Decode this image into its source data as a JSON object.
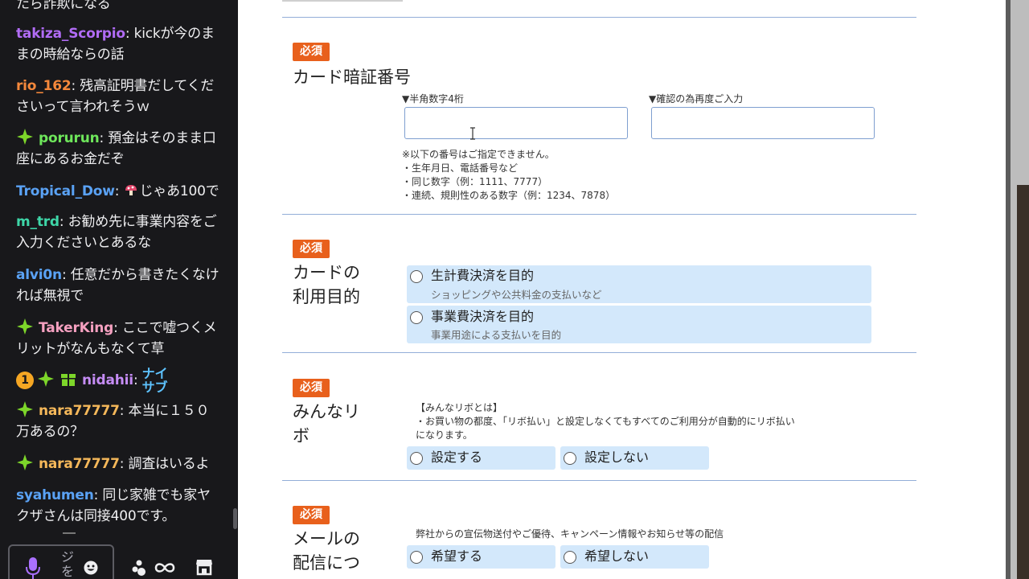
{
  "chat": {
    "messages": [
      {
        "user": "",
        "text": "たら詐欺になる"
      },
      {
        "user": "takiza_Scorpio",
        "color": "#b16cf5",
        "text": "kickが今のままの時給ならの話"
      },
      {
        "user": "rio_162",
        "color": "#f5883b",
        "text": "残高証明書だしてくださいって言われそうｗ"
      },
      {
        "user": "porurun",
        "color": "#6ee65b",
        "text": "預金はそのまま口座にあるお金だぞ"
      },
      {
        "user": "Tropical_Dow",
        "color": "#5aa2f5",
        "text": "じゃあ100で"
      },
      {
        "user": "m_trd",
        "color": "#3ed6a8",
        "text": "お勧め先に事業内容をご入力くださいとあるな"
      },
      {
        "user": "alvi0n",
        "color": "#5aa2f5",
        "text": "任意だから書きたくなければ無視で"
      },
      {
        "user": "TakerKing",
        "color": "#f5a0c0",
        "text": "ここで嘘つくメリットがなんもなくて草"
      },
      {
        "user": "nidahii",
        "color": "#c58cf5",
        "text": "",
        "emote": "ナイサブ",
        "badge_number": "1"
      },
      {
        "user": "nara77777",
        "color": "#f5b85a",
        "text": "本当に１５０万あるの？"
      },
      {
        "user": "nara77777",
        "color": "#f5b85a",
        "text": "調査はいるよ"
      },
      {
        "user": "syahumen",
        "color": "#5aa2f5",
        "text": "同じ家雑でも家ヤクザさんは同接400です。"
      }
    ],
    "input_ime_text": "ジを",
    "separator": ": "
  },
  "form": {
    "section1": {
      "required": "必須",
      "label": "カード暗証番号",
      "field1_caption": "▼半角数字4桁",
      "field2_caption": "▼確認の為再度ご入力",
      "notes": [
        "※以下の番号はご指定できません。",
        "・生年月日、電話番号など",
        "・同じ数字（例：1111、7777）",
        "・連続、規則性のある数字（例：1234、7878）"
      ]
    },
    "section2": {
      "required": "必須",
      "label_line1": "カードの",
      "label_line2": "利用目的",
      "options": [
        {
          "title": "生計費決済を目的",
          "sub": "ショッピングや公共料金の支払いなど"
        },
        {
          "title": "事業費決済を目的",
          "sub": "事業用途による支払いを目的"
        }
      ]
    },
    "section3": {
      "required": "必須",
      "label_line1": "みんなリ",
      "label_line2": "ボ",
      "desc_title": "【みんなリボとは】",
      "desc_line1": "・お買い物の都度、「リボ払い」と設定しなくてもすべてのご利用分が自動的にリボ払い",
      "desc_line2": "になります。",
      "options": [
        "設定する",
        "設定しない"
      ]
    },
    "section4": {
      "required": "必須",
      "label_line1": "メールの",
      "label_line2": "配信につ",
      "desc": "弊社からの宣伝物送付やご優待、キャンペーン情報やお知らせ等の配信",
      "options": [
        "希望する",
        "希望しない"
      ]
    }
  },
  "colors": {
    "chat_bg": "#18181b",
    "required_badge": "#e8601c",
    "option_bg": "#d3e8fb",
    "divider": "#93aed8",
    "subscriber_badge": "#7dd62a"
  }
}
